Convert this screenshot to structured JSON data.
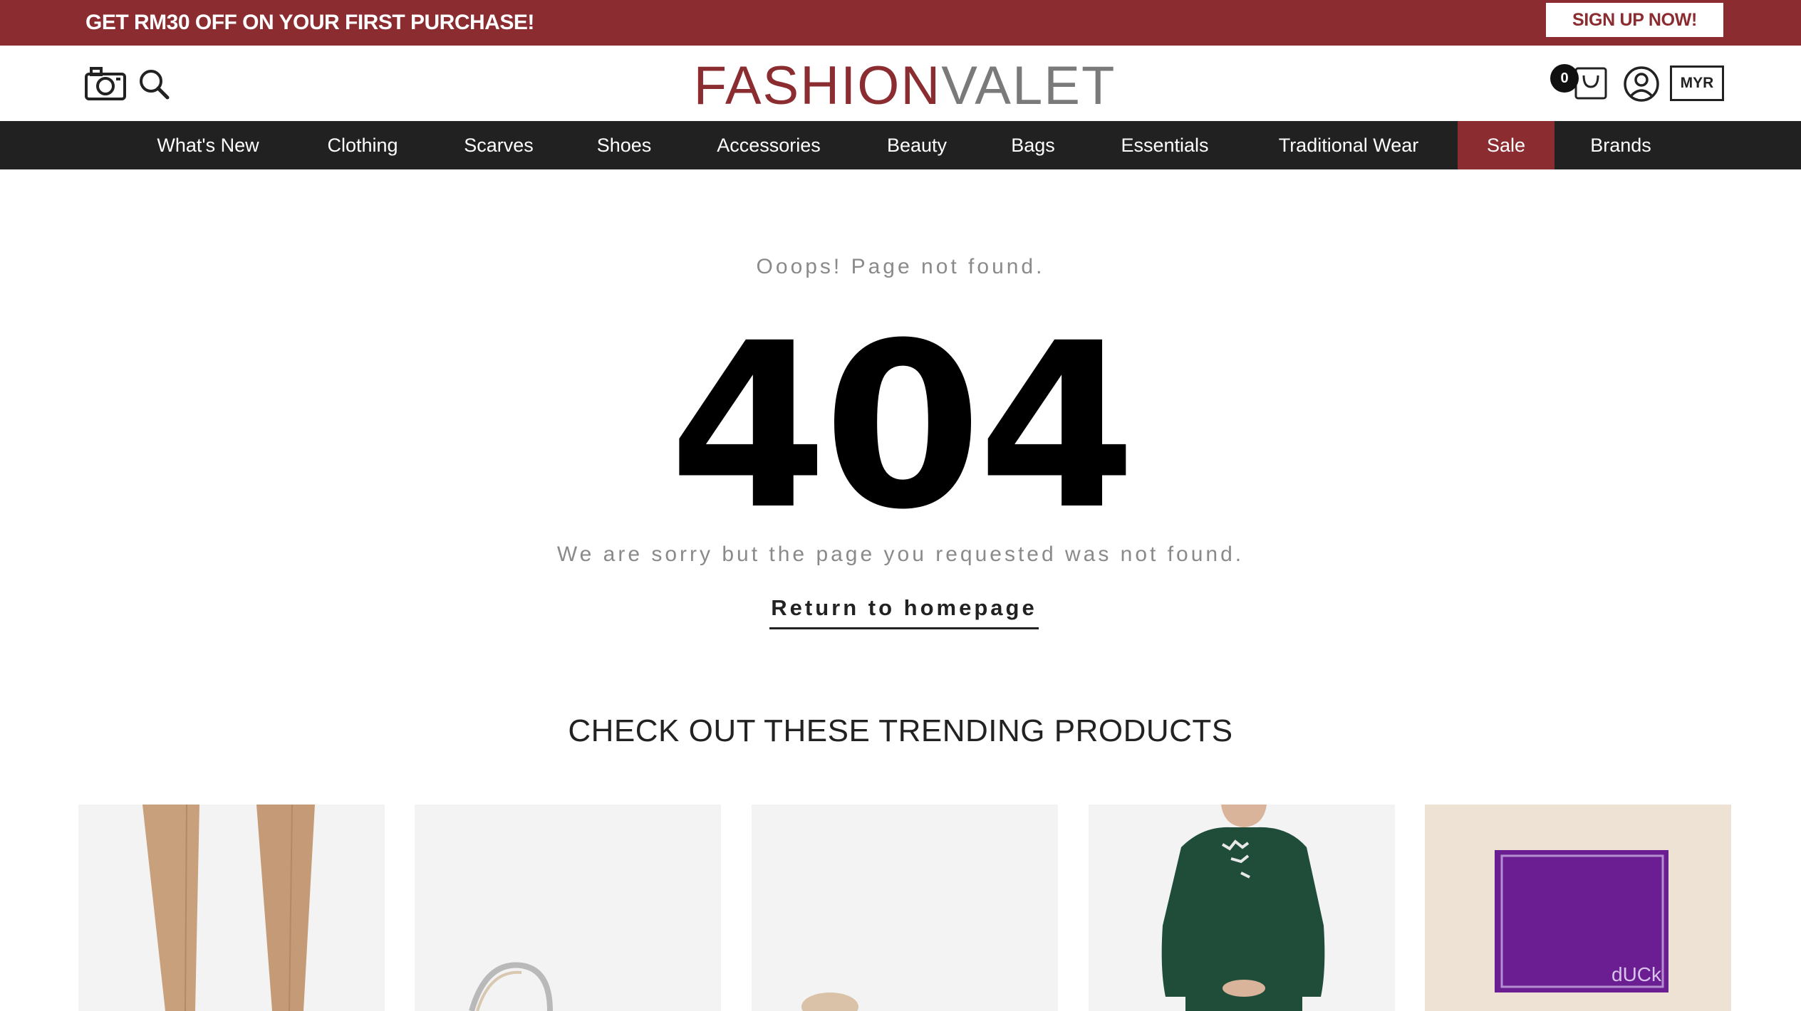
{
  "promo": {
    "text": "GET RM30 OFF ON YOUR FIRST PURCHASE!",
    "signup_label": "SIGN UP NOW!",
    "color": "#8b2c31"
  },
  "header": {
    "logo_part1": "FASHION",
    "logo_part2": "VALET",
    "cart_count": "0",
    "currency": "MYR",
    "icons": [
      "camera-icon",
      "search-icon",
      "cart-icon",
      "user-icon"
    ]
  },
  "nav": {
    "items": [
      {
        "label": "What's New"
      },
      {
        "label": "Clothing"
      },
      {
        "label": "Scarves"
      },
      {
        "label": "Shoes"
      },
      {
        "label": "Accessories"
      },
      {
        "label": "Beauty"
      },
      {
        "label": "Bags"
      },
      {
        "label": "Essentials"
      },
      {
        "label": "Traditional Wear"
      },
      {
        "label": "Sale"
      },
      {
        "label": "Brands"
      }
    ],
    "background": "#212121",
    "sale_color": "#8b2c31"
  },
  "error": {
    "oops": "Ooops! Page not found.",
    "code": "404",
    "message": "We are sorry but the page you requested was not found.",
    "return_label": "Return to homepage"
  },
  "trending": {
    "title": "CHECK OUT THESE TRENDING PRODUCTS",
    "products": [
      {
        "name": "beige-trousers"
      },
      {
        "name": "strappy-sandal"
      },
      {
        "name": "nude-heel"
      },
      {
        "name": "green-embroidered-blouse"
      },
      {
        "name": "purple-dUCk-box",
        "brand_mark": "dUCk"
      }
    ]
  }
}
